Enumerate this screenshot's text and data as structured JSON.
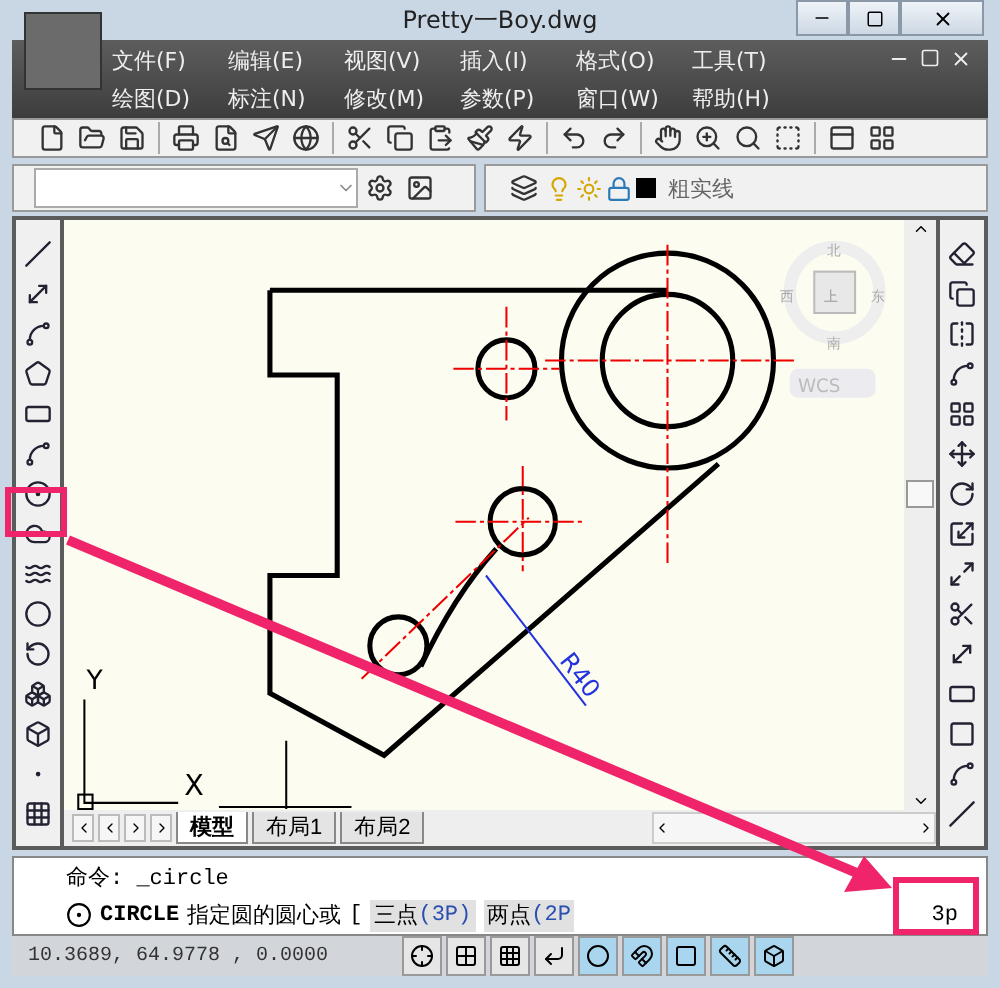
{
  "window": {
    "title": "Pretty一Boy.dwg"
  },
  "menu_rows": [
    {
      "items": [
        "文件(F)",
        "编辑(E)",
        "视图(V)",
        "插入(I)",
        "格式(O)",
        "工具(T)"
      ]
    },
    {
      "items": [
        "绘图(D)",
        "标注(N)",
        "修改(M)",
        "参数(P)",
        "窗口(W)",
        "帮助(H)"
      ]
    }
  ],
  "layer_toolbar": {
    "layer_name": "粗实线"
  },
  "viewcube": {
    "north": "北",
    "west": "西",
    "east": "东",
    "south": "南",
    "top": "上",
    "ucs": "WCS"
  },
  "drawing": {
    "dimension": "R40",
    "axis_x": "X",
    "axis_y": "Y"
  },
  "layout_tabs": [
    {
      "label": "模型",
      "selected": true
    },
    {
      "label": "布局1",
      "selected": false
    },
    {
      "label": "布局2",
      "selected": false
    }
  ],
  "command_line": {
    "history": "命令: _circle",
    "command": "CIRCLE",
    "prompt": "指定圆的圆心或",
    "bracket": "[",
    "options": [
      {
        "label": "三点",
        "key": "(3P)"
      },
      {
        "label": "两点",
        "key": "(2P"
      }
    ],
    "input": "3p"
  },
  "status_bar": {
    "coordinates": "10.3689,  64.9778 , 0.0000",
    "toggles": [
      {
        "on": false
      },
      {
        "on": false
      },
      {
        "on": false
      },
      {
        "on": false
      },
      {
        "on": true
      },
      {
        "on": true
      },
      {
        "on": true
      },
      {
        "on": true
      },
      {
        "on": true
      }
    ]
  }
}
